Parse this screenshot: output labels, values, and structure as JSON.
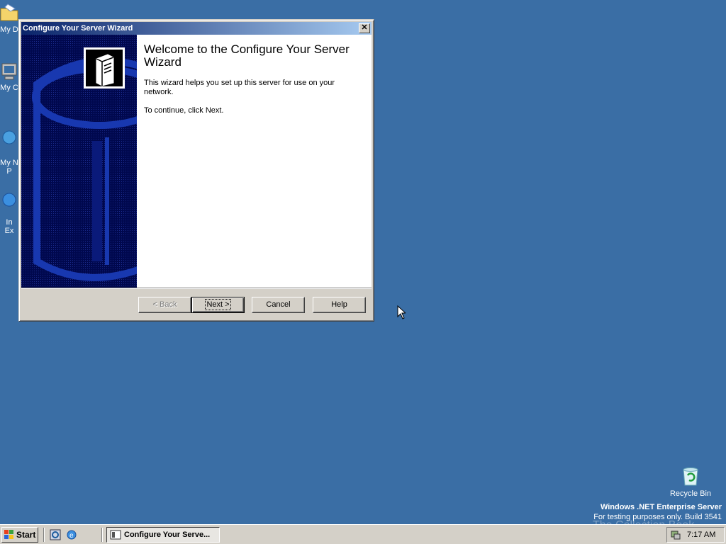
{
  "desktop": {
    "icons": [
      {
        "label": "My D"
      },
      {
        "label": "My C"
      },
      {
        "label": "My N\nP"
      },
      {
        "label": "In\nEx"
      }
    ],
    "recycle_bin": "Recycle Bin",
    "branding": {
      "line1": "Windows .NET Enterprise Server",
      "line2": "For testing purposes only. Build 3541"
    },
    "watermark": "The Collection Book"
  },
  "window": {
    "title": "Configure Your Server Wizard",
    "close_glyph": "✕",
    "heading": "Welcome to the Configure Your Server Wizard",
    "paragraph1": "This wizard helps you set up this server for use on your network.",
    "paragraph2": "To continue, click Next.",
    "buttons": {
      "back": "< Back",
      "next": "Next >",
      "cancel": "Cancel",
      "help": "Help"
    }
  },
  "taskbar": {
    "start": "Start",
    "task_label": "Configure Your Serve...",
    "clock": "7:17 AM"
  }
}
